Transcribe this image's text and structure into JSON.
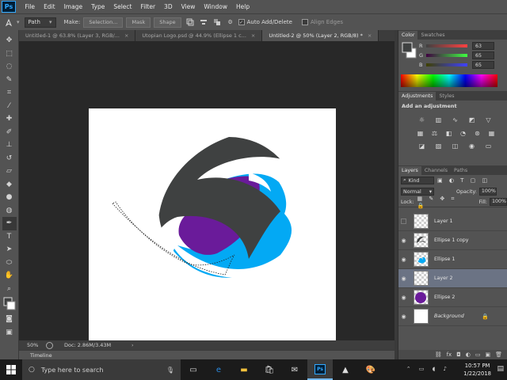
{
  "app": {
    "logo": "Ps",
    "accent": "#31a8ff"
  },
  "menu": [
    "File",
    "Edit",
    "Image",
    "Type",
    "Select",
    "Filter",
    "3D",
    "View",
    "Window",
    "Help"
  ],
  "options": {
    "mode": "Path",
    "make_label": "Make:",
    "selection_btn": "Selection...",
    "mask_btn": "Mask",
    "shape_btn": "Shape",
    "auto_add_delete": "Auto Add/Delete",
    "align_edges": "Align Edges"
  },
  "tabs": [
    {
      "label": "Untitled-1 @ 63.8% (Layer 3, RGB/...",
      "close": "×"
    },
    {
      "label": "Utopian Logo.psd @ 44.9% (Ellipse 1 c...",
      "close": "×"
    },
    {
      "label": "Untitled-2 @ 50% (Layer 2, RGB/8) *",
      "close": "×"
    }
  ],
  "status": {
    "zoom": "50%",
    "doc": "Doc: 2.86M/3.43M",
    "arrow": "›"
  },
  "timeline": {
    "label": "Timeline"
  },
  "color_panel": {
    "tabs": [
      "Color",
      "Swatches"
    ],
    "channels": [
      {
        "label": "R",
        "value": "63"
      },
      {
        "label": "G",
        "value": "65"
      },
      {
        "label": "B",
        "value": "65"
      }
    ]
  },
  "adjustments_panel": {
    "tabs": [
      "Adjustments",
      "Styles"
    ],
    "heading": "Add an adjustment"
  },
  "layers_panel": {
    "tabs": [
      "Layers",
      "Channels",
      "Paths"
    ],
    "kind": "Kind",
    "blend_mode": "Normal",
    "opacity_label": "Opacity:",
    "opacity": "100%",
    "lock_label": "Lock:",
    "fill_label": "Fill:",
    "fill": "100%",
    "layers": [
      {
        "name": "Layer 1",
        "visible": false
      },
      {
        "name": "Ellipse 1 copy",
        "visible": true
      },
      {
        "name": "Ellipse 1",
        "visible": true
      },
      {
        "name": "Layer 2",
        "visible": true,
        "selected": true
      },
      {
        "name": "Ellipse 2",
        "visible": true
      },
      {
        "name": "Background",
        "visible": true,
        "locked": true
      }
    ]
  },
  "taskbar": {
    "search_placeholder": "Type here to search",
    "time": "10:57 PM",
    "date": "1/22/2018",
    "icons": [
      "task-view-icon",
      "edge-icon",
      "file-explorer-icon",
      "store-icon",
      "mail-icon",
      "photoshop-icon",
      "photos-icon",
      "paint-icon"
    ]
  },
  "colors": {
    "dark_gray": "#3f4141",
    "purple": "#6a1b9a",
    "cyan": "#03a9f4"
  }
}
